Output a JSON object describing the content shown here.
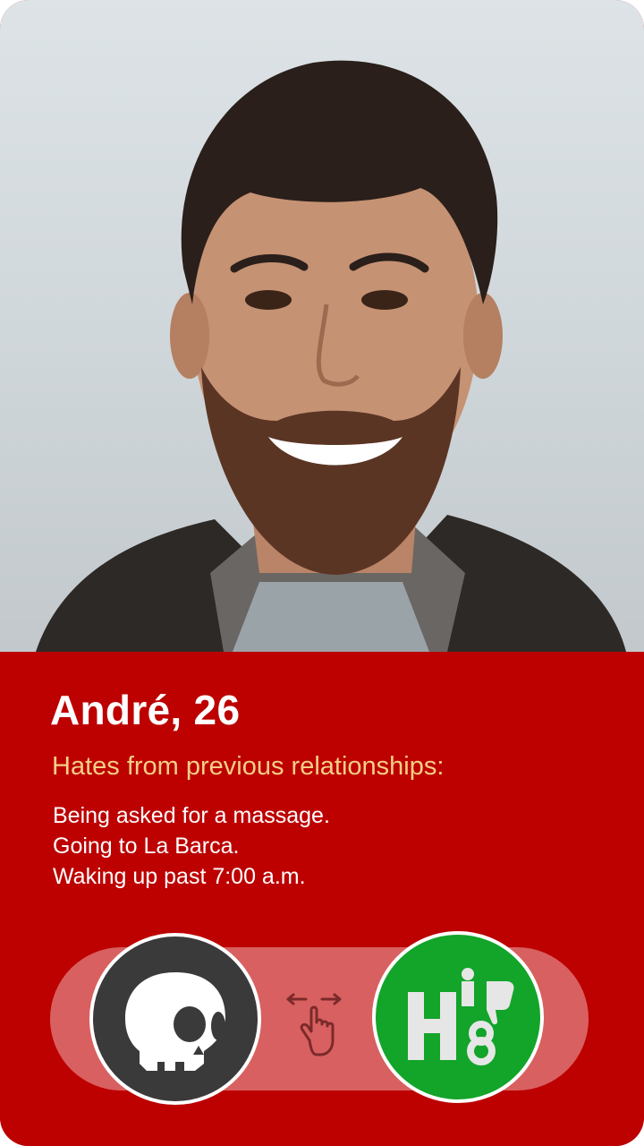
{
  "profile": {
    "name_age": "André, 26",
    "subtitle": "Hates from previous relationships:",
    "hates": [
      "Being asked for a massage.",
      "Going to La Barca.",
      "Waking up past 7:00 a.m."
    ]
  },
  "actions": {
    "reject_icon": "skull-icon",
    "hate_icon": "h8-thumbs-down-icon",
    "hint_icon": "swipe-hand-icon"
  },
  "colors": {
    "card_red": "#bd0000",
    "subtitle_gold": "#f4cf86",
    "skull_button": "#3a3a3a",
    "hate_button": "#13a42a",
    "track": "#d96060"
  }
}
